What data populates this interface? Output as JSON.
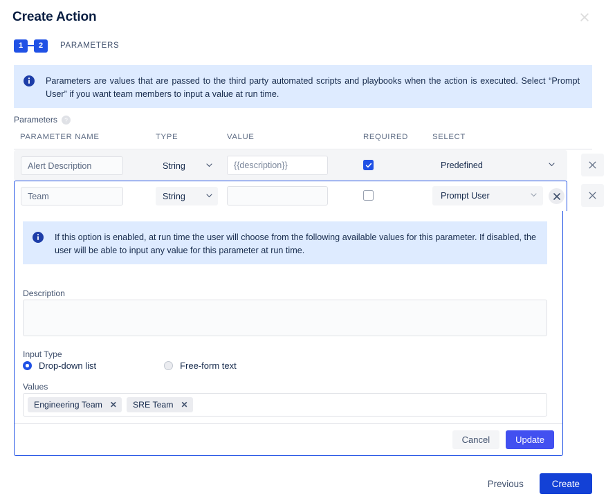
{
  "dialog": {
    "title": "Create Action",
    "close_icon": "close-icon"
  },
  "steps": {
    "step1": "1",
    "step2": "2",
    "current_label": "PARAMETERS"
  },
  "top_banner": {
    "icon": "info-icon",
    "text": "Parameters are values that are passed to the third party automated scripts and playbooks when the action is executed. Select “Prompt User” if you want team members to input a value at run time."
  },
  "parameters_section": {
    "label": "Parameters",
    "help_icon": "help-icon",
    "columns": {
      "name": "PARAMETER NAME",
      "type": "TYPE",
      "value": "VALUE",
      "required": "REQUIRED",
      "select": "SELECT"
    },
    "rows": [
      {
        "name_value": "",
        "name_placeholder": "Alert Description",
        "type": "String",
        "value_value": "",
        "value_placeholder": "{{description}}",
        "required": true,
        "select": "Predefined",
        "has_clear": false,
        "active": false,
        "remove_icon": "close-icon"
      },
      {
        "name_value": "",
        "name_placeholder": "Team",
        "type": "String",
        "value_value": "",
        "value_placeholder": "",
        "required": false,
        "select": "Prompt User",
        "has_clear": true,
        "active": true,
        "remove_icon": "close-icon"
      }
    ]
  },
  "expanded_panel": {
    "banner": {
      "icon": "info-icon",
      "text": "If this option is enabled, at run time the user will choose from the following available values for this parameter. If disabled, the user will be able to input any value for this parameter at run time."
    },
    "description_label": "Description",
    "description_value": "",
    "input_type_label": "Input Type",
    "input_type_options": [
      {
        "label": "Drop-down list",
        "selected": true
      },
      {
        "label": "Free-form text",
        "selected": false
      }
    ],
    "values_label": "Values",
    "values_chips": [
      {
        "label": "Engineering Team",
        "remove_icon": "close-icon"
      },
      {
        "label": "SRE Team",
        "remove_icon": "close-icon"
      }
    ],
    "cancel_label": "Cancel",
    "update_label": "Update"
  },
  "footer": {
    "previous_label": "Previous",
    "create_label": "Create"
  },
  "colors": {
    "accent_blue": "#2051e5",
    "create_blue": "#1341d6",
    "update_blue": "#4250f0",
    "banner_bg": "#deebff",
    "row_bg": "#f4f5f7",
    "text_primary": "#172b4d",
    "text_muted": "#5e6c84"
  }
}
